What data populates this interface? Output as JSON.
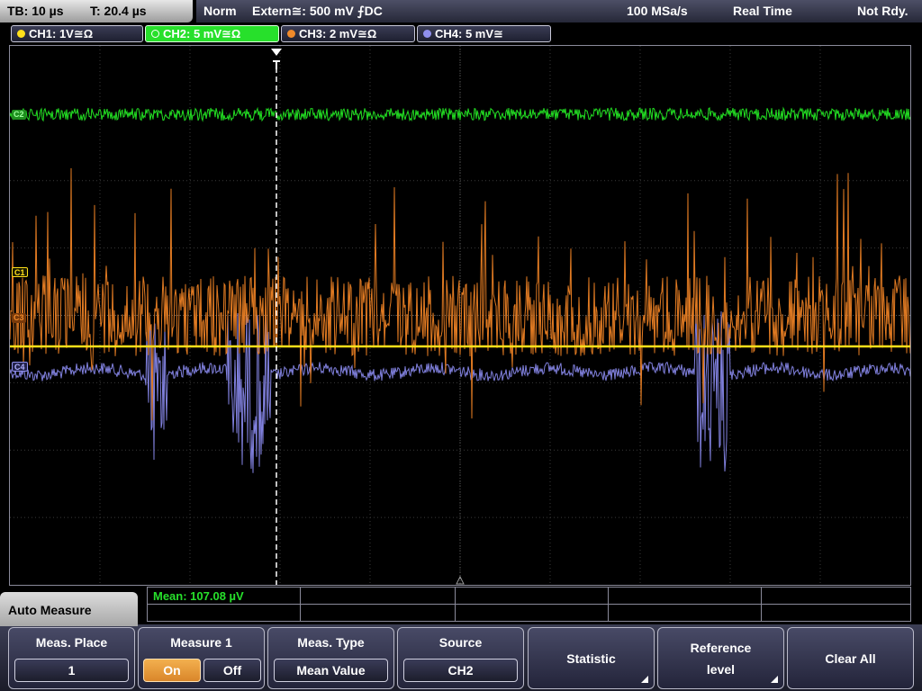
{
  "status": {
    "timebase": "TB: 10 µs",
    "trigger_time": "T: 20.4 µs",
    "mode": "Norm",
    "trigger_source": "Extern≅: 500 mV ⨍DC",
    "sample_rate": "100 MSa/s",
    "acquisition": "Real Time",
    "ready_state": "Not Rdy."
  },
  "channels": [
    {
      "label": "CH1: 1V≅Ω",
      "color": "#ffe01a",
      "active": false
    },
    {
      "label": "CH2: 5 mV≅Ω",
      "color": "#27e02b",
      "active": true
    },
    {
      "label": "CH3: 2 mV≅Ω",
      "color": "#f08a2a",
      "active": false
    },
    {
      "label": "CH4: 5 mV≅",
      "color": "#9090ee",
      "active": false
    }
  ],
  "markers": {
    "c1": "C1",
    "c2": "C2",
    "c3": "C3",
    "c4": "C4",
    "trigger": "T"
  },
  "measurement": {
    "result": "Mean: 107.08 µV"
  },
  "menu": {
    "title": "Auto Measure",
    "softkeys": {
      "meas_place": {
        "label": "Meas. Place",
        "value": "1"
      },
      "measure1": {
        "label": "Measure 1",
        "on": "On",
        "off": "Off"
      },
      "meas_type": {
        "label": "Meas. Type",
        "value": "Mean Value"
      },
      "source": {
        "label": "Source",
        "value": "CH2"
      },
      "statistic": {
        "label": "Statistic"
      },
      "reference": {
        "label_line1": "Reference",
        "label_line2": "level"
      },
      "clear_all": {
        "label": "Clear All"
      }
    }
  },
  "icons": {
    "trigger_marker": "trigger-position-icon",
    "submenu": "submenu-corner-icon"
  },
  "colors": {
    "ch1": "#ffe01a",
    "ch2": "#27e02b",
    "ch3": "#f08a2a",
    "ch4": "#9090ee",
    "measure_on": "#e99a3a"
  }
}
